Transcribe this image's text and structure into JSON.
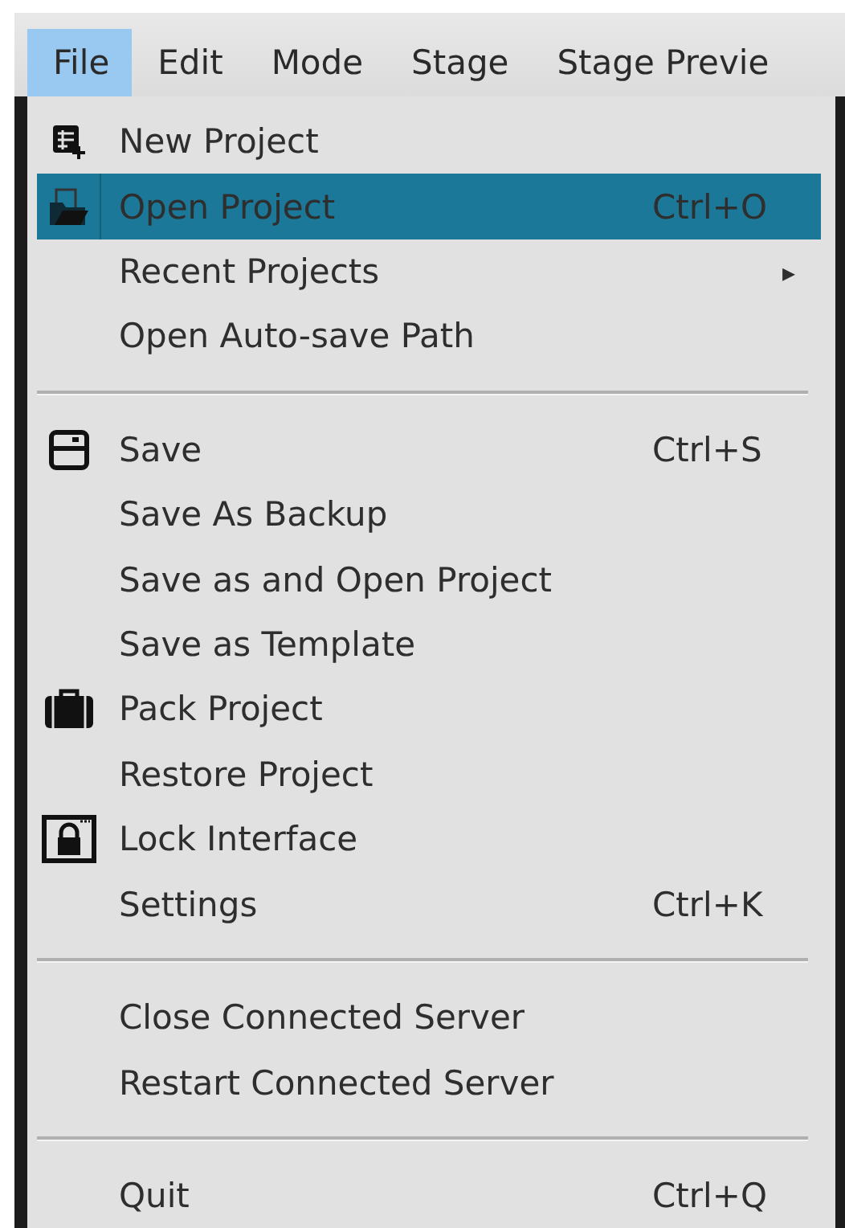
{
  "menubar": [
    {
      "label": "File",
      "selected": true
    },
    {
      "label": "Edit",
      "selected": false
    },
    {
      "label": "Mode",
      "selected": false
    },
    {
      "label": "Stage",
      "selected": false
    },
    {
      "label": "Stage Previe",
      "selected": false
    }
  ],
  "menu": [
    {
      "kind": "item",
      "label": "New Project",
      "selected": false
    },
    {
      "kind": "item",
      "label": "Open Project",
      "shortcut": "Ctrl+O",
      "selected": true
    },
    {
      "kind": "submenu",
      "label": "Recent Projects",
      "arrow": "▸",
      "selected": false
    },
    {
      "kind": "item",
      "label": "Open Auto-save Path",
      "selected": false
    },
    {
      "kind": "separator"
    },
    {
      "kind": "item",
      "label": "Save",
      "shortcut": "Ctrl+S",
      "selected": false
    },
    {
      "kind": "item",
      "label": "Save As Backup",
      "selected": false
    },
    {
      "kind": "item",
      "label": "Save as and Open Project",
      "selected": false
    },
    {
      "kind": "item",
      "label": "Save as Template",
      "selected": false
    },
    {
      "kind": "item",
      "label": "Pack Project",
      "selected": false
    },
    {
      "kind": "item",
      "label": "Restore Project",
      "selected": false
    },
    {
      "kind": "item",
      "label": "Lock Interface",
      "selected": false
    },
    {
      "kind": "item",
      "label": "Settings",
      "shortcut": "Ctrl+K",
      "selected": false
    },
    {
      "kind": "separator"
    },
    {
      "kind": "item",
      "label": "Close Connected Server",
      "selected": false
    },
    {
      "kind": "item",
      "label": "Restart Connected Server",
      "selected": false
    },
    {
      "kind": "separator"
    },
    {
      "kind": "item",
      "label": "Quit",
      "shortcut": "Ctrl+Q",
      "selected": false
    }
  ]
}
